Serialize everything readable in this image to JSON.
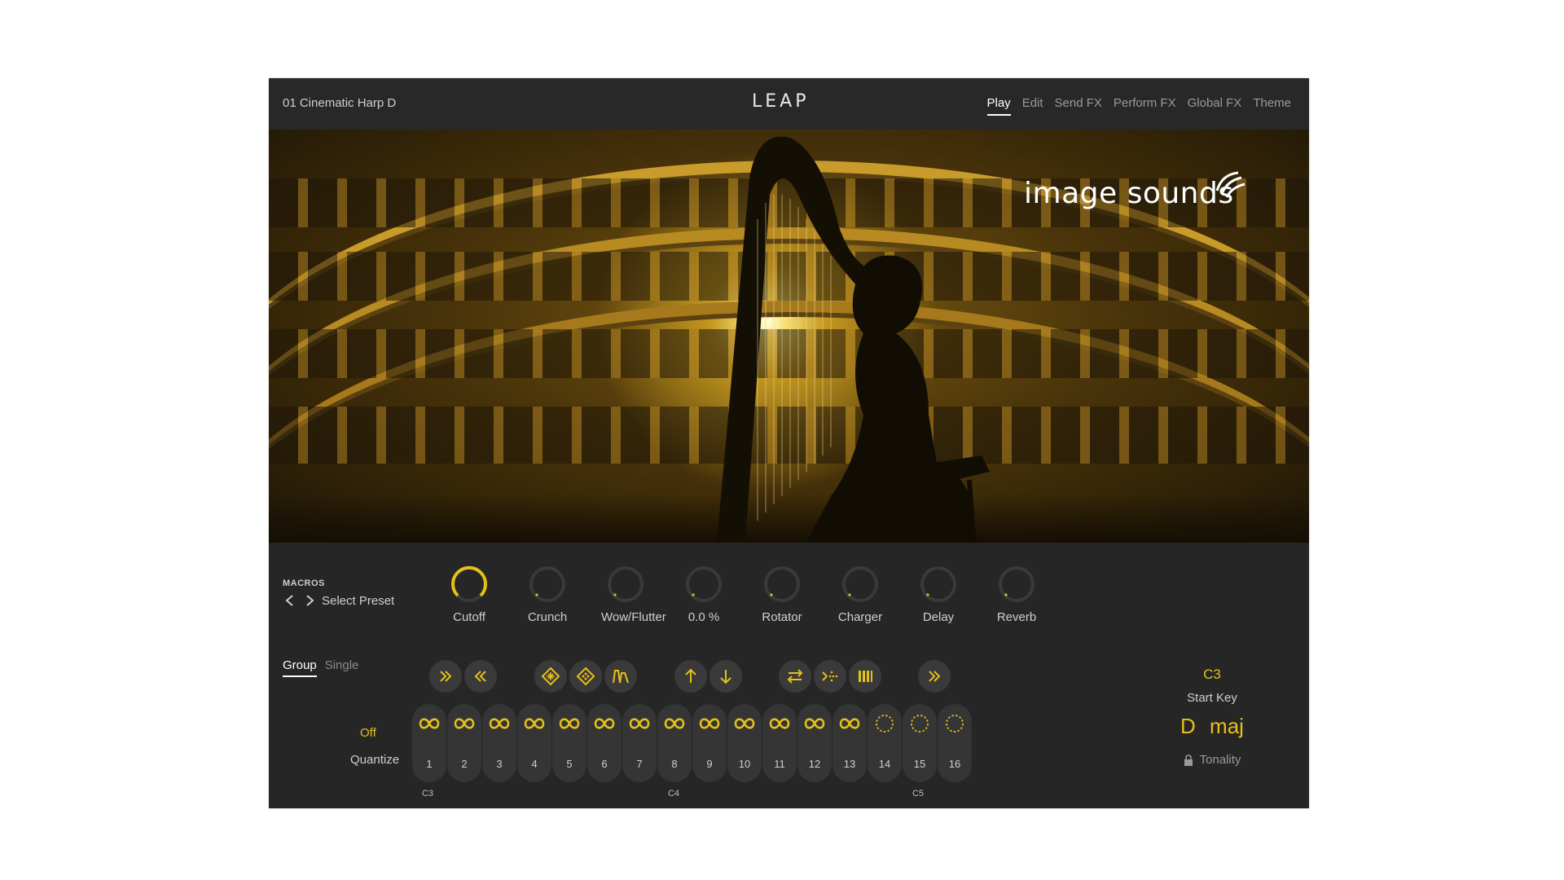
{
  "header": {
    "preset_name": "01 Cinematic Harp D",
    "logo": "LEAP",
    "tabs": [
      {
        "label": "Play",
        "active": true
      },
      {
        "label": "Edit",
        "active": false
      },
      {
        "label": "Send FX",
        "active": false
      },
      {
        "label": "Perform FX",
        "active": false
      },
      {
        "label": "Global FX",
        "active": false
      },
      {
        "label": "Theme",
        "active": false
      }
    ]
  },
  "hero": {
    "brand": "image sounds"
  },
  "macros": {
    "title": "MACROS",
    "preset_selector": "Select Preset",
    "knobs": [
      {
        "label": "Cutoff",
        "active": true
      },
      {
        "label": "Crunch",
        "active": false
      },
      {
        "label": "Wow/Flutter",
        "active": false
      },
      {
        "label": "0.0 %",
        "active": false
      },
      {
        "label": "Rotator",
        "active": false
      },
      {
        "label": "Charger",
        "active": false
      },
      {
        "label": "Delay",
        "active": false
      },
      {
        "label": "Reverb",
        "active": false
      }
    ]
  },
  "mode_tabs": [
    {
      "label": "Group",
      "active": true
    },
    {
      "label": "Single",
      "active": false
    }
  ],
  "quantize": {
    "value": "Off",
    "label": "Quantize"
  },
  "pads": [
    {
      "number": "1",
      "icon": "loop-icon"
    },
    {
      "number": "2",
      "icon": "loop-icon"
    },
    {
      "number": "3",
      "icon": "loop-icon"
    },
    {
      "number": "4",
      "icon": "loop-icon"
    },
    {
      "number": "5",
      "icon": "loop-icon"
    },
    {
      "number": "6",
      "icon": "loop-icon"
    },
    {
      "number": "7",
      "icon": "loop-icon"
    },
    {
      "number": "8",
      "icon": "loop-icon"
    },
    {
      "number": "9",
      "icon": "loop-icon"
    },
    {
      "number": "10",
      "icon": "loop-icon"
    },
    {
      "number": "11",
      "icon": "loop-icon"
    },
    {
      "number": "12",
      "icon": "loop-icon"
    },
    {
      "number": "13",
      "icon": "loop-icon"
    },
    {
      "number": "14",
      "icon": "empty-slot-icon"
    },
    {
      "number": "15",
      "icon": "empty-slot-icon"
    },
    {
      "number": "16",
      "icon": "empty-slot-icon"
    }
  ],
  "note_labels": [
    "C3",
    "C4",
    "C5"
  ],
  "start_key": {
    "value": "C3",
    "label": "Start Key"
  },
  "tonality": {
    "value": "D  maj",
    "label": "Tonality"
  },
  "colors": {
    "accent": "#e6c01a",
    "panel": "#262626",
    "header": "#282828",
    "pad": "#353535"
  }
}
